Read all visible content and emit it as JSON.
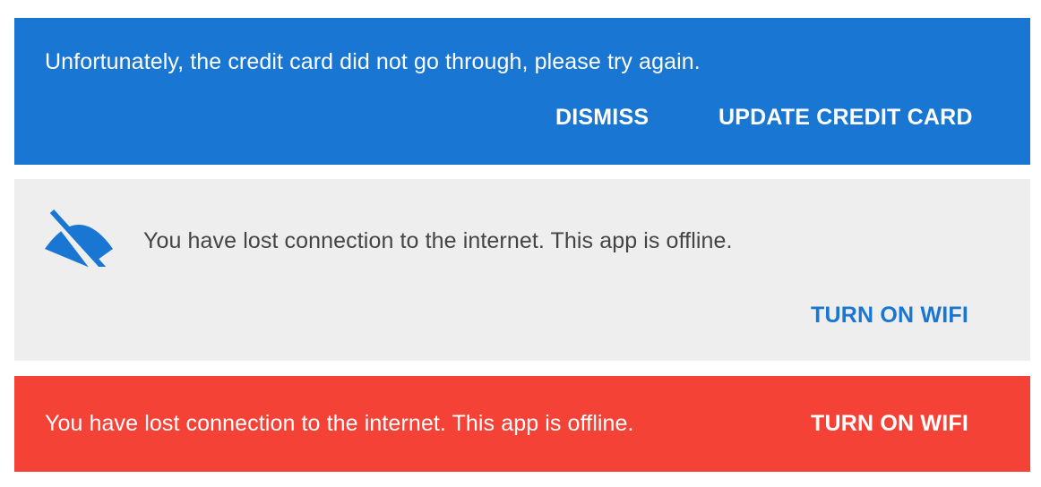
{
  "colors": {
    "blue_banner": "#1976d2",
    "grey_banner": "#eeeeee",
    "red_banner": "#f44336",
    "accent": "#1976d2"
  },
  "payment_banner": {
    "message": "Unfortunately, the credit card did not go through, please try again.",
    "dismiss_label": "DISMISS",
    "update_label": "UPDATE CREDIT CARD"
  },
  "offline_banner": {
    "icon": "wifi-off-icon",
    "message": "You have lost connection to the internet. This app is offline.",
    "action_label": "TURN ON WIFI"
  },
  "offline_banner_compact": {
    "message": "You have lost connection to the internet. This app is offline.",
    "action_label": "TURN ON WIFI"
  }
}
